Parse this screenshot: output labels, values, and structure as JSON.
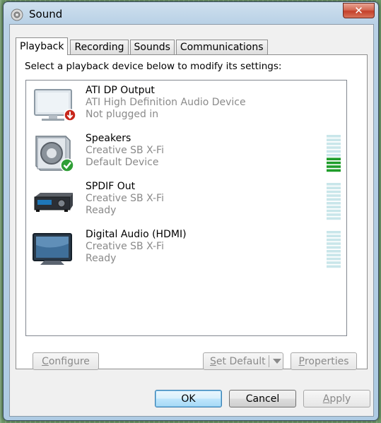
{
  "window": {
    "title": "Sound",
    "close_glyph": "✕"
  },
  "tabs": [
    {
      "label": "Playback",
      "active": true
    },
    {
      "label": "Recording",
      "active": false
    },
    {
      "label": "Sounds",
      "active": false
    },
    {
      "label": "Communications",
      "active": false
    }
  ],
  "instruction": "Select a playback device below to modify its settings:",
  "devices": [
    {
      "name": "ATI DP Output",
      "driver": "ATI High Definition Audio Device",
      "status": "Not plugged in",
      "icon": "monitor-disconnected-icon",
      "badge": "down-arrow-badge-icon",
      "level_segments": 0,
      "has_meter": false
    },
    {
      "name": "Speakers",
      "driver": "Creative SB X-Fi",
      "status": "Default Device",
      "icon": "speaker-icon",
      "badge": "green-check-badge-icon",
      "level_segments": 4,
      "has_meter": true
    },
    {
      "name": "SPDIF Out",
      "driver": "Creative SB X-Fi",
      "status": "Ready",
      "icon": "receiver-icon",
      "badge": "",
      "level_segments": 0,
      "has_meter": true
    },
    {
      "name": "Digital Audio (HDMI)",
      "driver": "Creative SB X-Fi",
      "status": "Ready",
      "icon": "monitor-icon",
      "badge": "",
      "level_segments": 0,
      "has_meter": true
    }
  ],
  "buttons": {
    "configure": {
      "mnemonic": "C",
      "rest": "onfigure"
    },
    "set_default": {
      "mnemonic": "S",
      "rest": "et Default"
    },
    "properties": {
      "mnemonic": "P",
      "rest": "roperties"
    },
    "ok": "OK",
    "cancel": "Cancel",
    "apply": {
      "mnemonic": "A",
      "rest": "pply"
    }
  },
  "colors": {
    "meter_active": "#1f9d2a",
    "meter_idle": "#c9e6ea",
    "check_badge": "#2e9e35",
    "alert_badge": "#c7261b"
  }
}
